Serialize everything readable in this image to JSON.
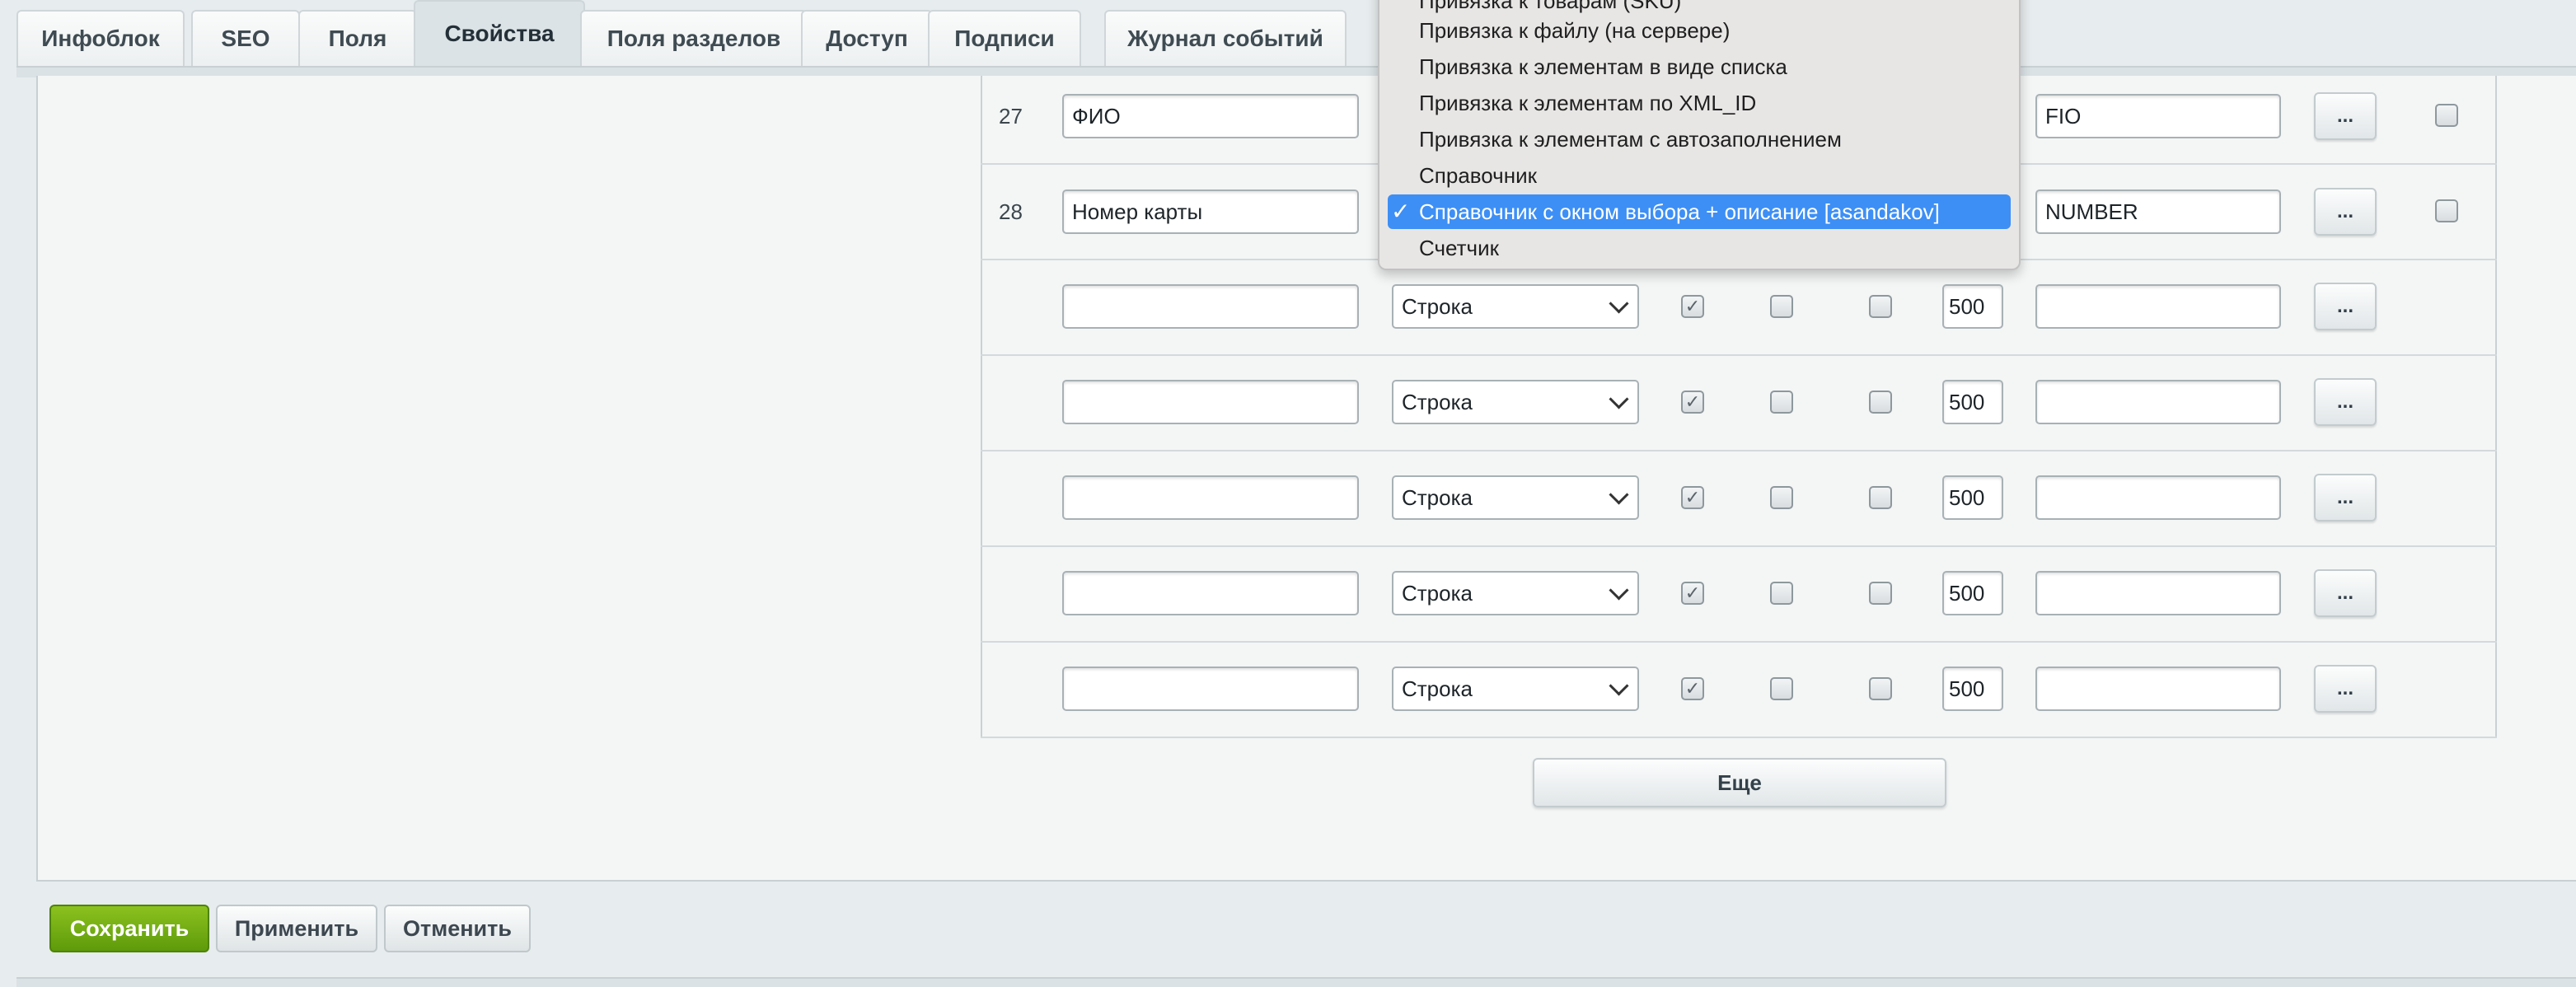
{
  "tabs": [
    {
      "label": "Инфоблок"
    },
    {
      "label": "SEO"
    },
    {
      "label": "Поля"
    },
    {
      "label": "Свойства"
    },
    {
      "label": "Поля разделов"
    },
    {
      "label": "Доступ"
    },
    {
      "label": "Подписи"
    },
    {
      "label": "Журнал событий"
    }
  ],
  "active_tab": "Свойства",
  "rows": [
    {
      "num": "27",
      "name": "ФИО",
      "code": "FIO"
    },
    {
      "num": "28",
      "name": "Номер карты",
      "code": "NUMBER"
    }
  ],
  "new_rows": {
    "type_label": "Строка",
    "sort_value": "500",
    "dots": "..."
  },
  "more_button": "Еще",
  "footer": {
    "save": "Сохранить",
    "apply": "Применить",
    "cancel": "Отменить"
  },
  "dropdown": {
    "options": [
      {
        "label": "Привязка к товарам (SKU)"
      },
      {
        "label": "Привязка к файлу (на сервере)"
      },
      {
        "label": "Привязка к элементам в виде списка"
      },
      {
        "label": "Привязка к элементам по XML_ID"
      },
      {
        "label": "Привязка к элементам с автозаполнением"
      },
      {
        "label": "Справочник"
      },
      {
        "label": "Справочник с окном выбора + описание [asandakov]"
      },
      {
        "label": "Счетчик"
      }
    ],
    "check_glyph": "✓"
  }
}
